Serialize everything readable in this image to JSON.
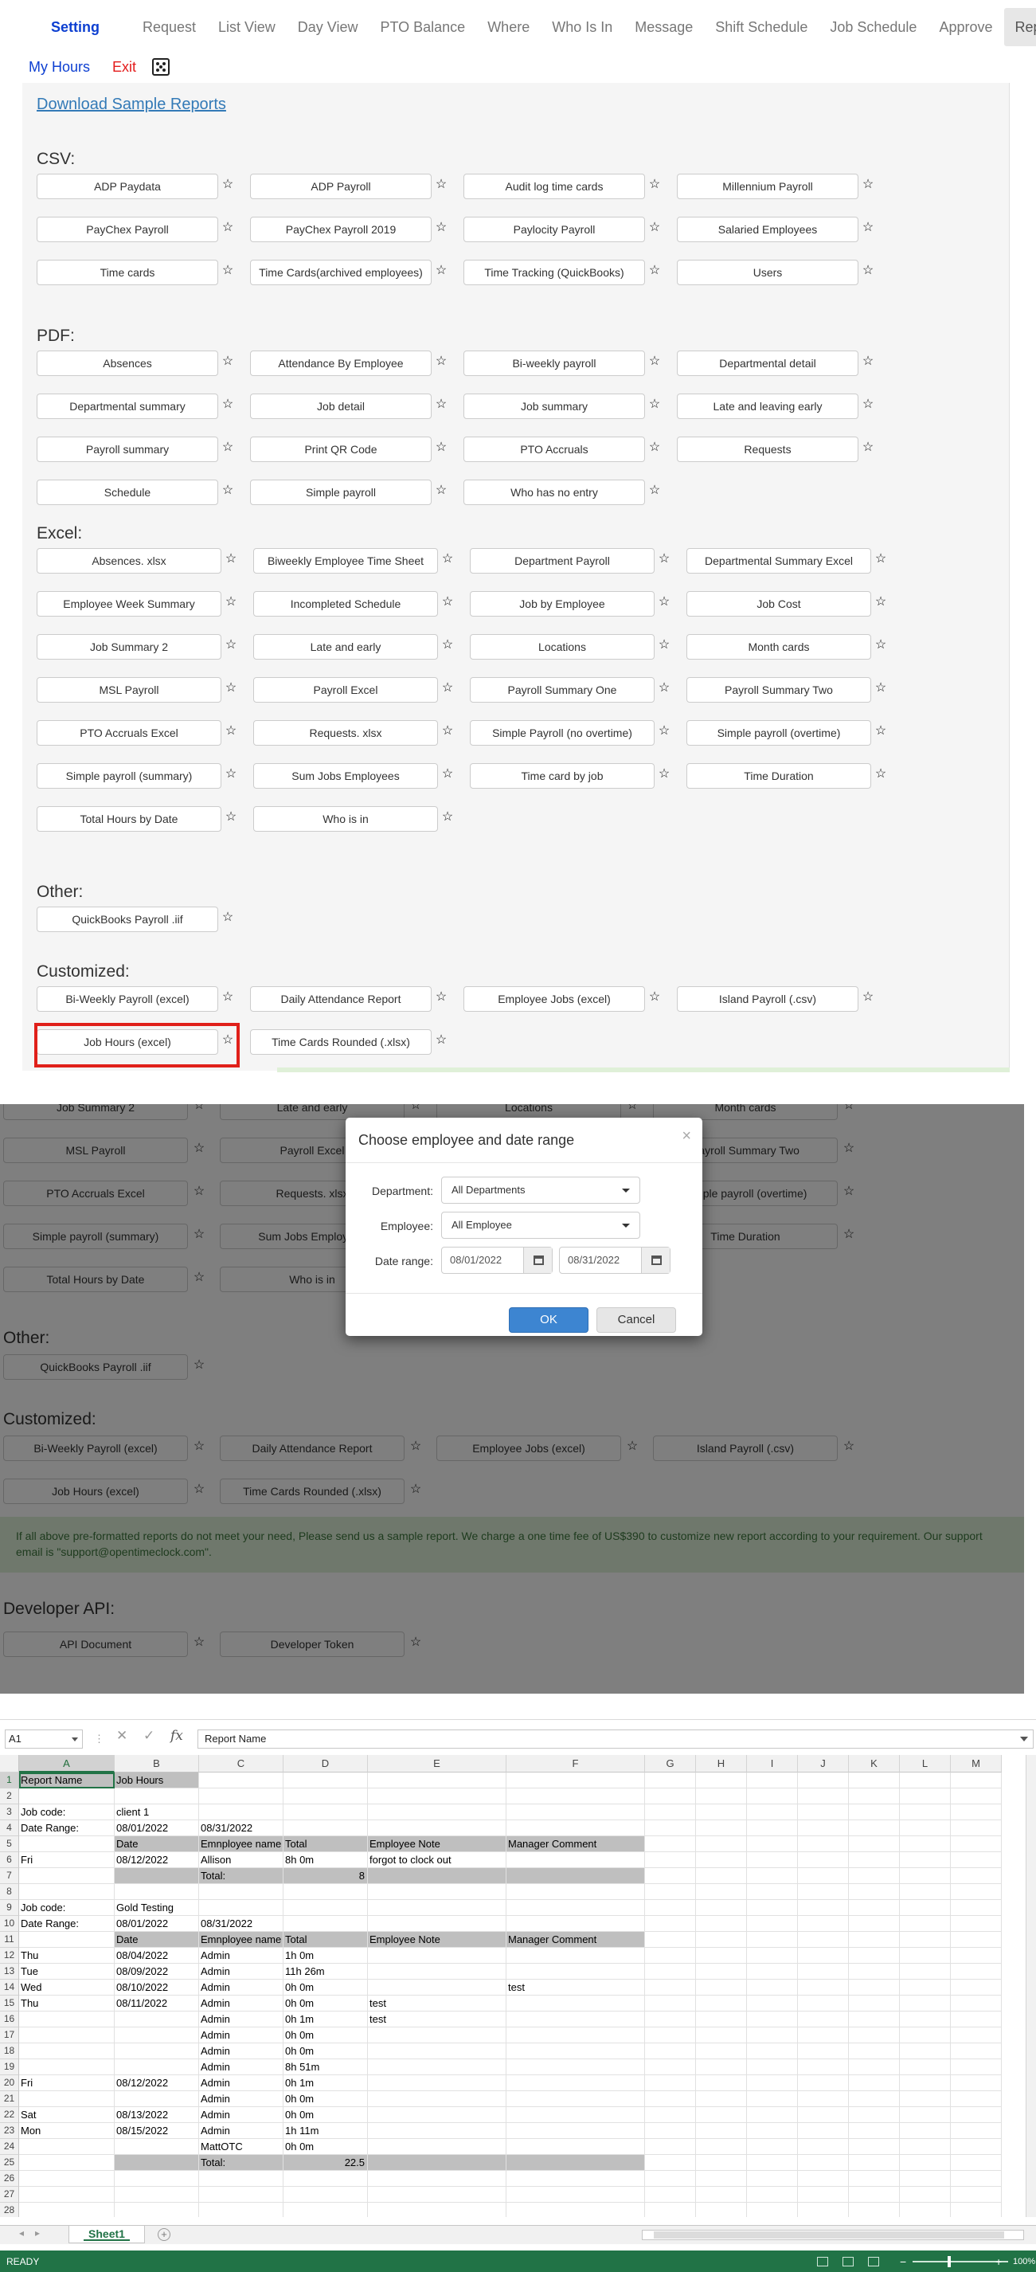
{
  "nav": {
    "brand": "Setting",
    "items": [
      "Request",
      "List View",
      "Day View",
      "PTO Balance",
      "Where",
      "Who Is In",
      "Message",
      "Shift Schedule",
      "Job Schedule",
      "Approve",
      "Reports"
    ],
    "active": "Reports",
    "row2": {
      "my_hours": "My Hours",
      "exit": "Exit",
      "icon": "dice-icon"
    }
  },
  "reports": {
    "download_link": "Download Sample Reports",
    "sections": [
      {
        "title": "CSV:",
        "items": [
          "ADP Paydata",
          "ADP Payroll",
          "Audit log time cards",
          "Millennium Payroll",
          "PayChex Payroll",
          "PayChex Payroll 2019",
          "Paylocity Payroll",
          "Salaried Employees",
          "Time cards",
          "Time Cards(archived employees)",
          "Time Tracking (QuickBooks)",
          "Users"
        ]
      },
      {
        "title": "PDF:",
        "items": [
          "Absences",
          "Attendance By Employee",
          "Bi-weekly payroll",
          "Departmental detail",
          "Departmental summary",
          "Job detail",
          "Job summary",
          "Late and leaving early",
          "Payroll summary",
          "Print QR Code",
          "PTO Accruals",
          "Requests",
          "Schedule",
          "Simple payroll",
          "Who has no entry"
        ]
      },
      {
        "title": "Excel:",
        "items": [
          "Absences. xlsx",
          "Biweekly Employee Time Sheet",
          "Department Payroll",
          "Departmental Summary Excel",
          "Employee Week Summary",
          "Incompleted Schedule",
          "Job by Employee",
          "Job Cost",
          "Job Summary 2",
          "Late and early",
          "Locations",
          "Month cards",
          "MSL Payroll",
          "Payroll Excel",
          "Payroll Summary One",
          "Payroll Summary Two",
          "PTO Accruals Excel",
          "Requests. xlsx",
          "Simple Payroll (no overtime)",
          "Simple payroll (overtime)",
          "Simple payroll (summary)",
          "Sum Jobs Employees",
          "Time card by job",
          "Time Duration",
          "Total Hours by Date",
          "Who is in"
        ]
      },
      {
        "title": "Other:",
        "items": [
          "QuickBooks Payroll .iif"
        ]
      },
      {
        "title": "Customized:",
        "items": [
          "Bi-Weekly Payroll (excel)",
          "Daily Attendance Report",
          "Employee Jobs (excel)",
          "Island Payroll (.csv)",
          "Job Hours (excel)",
          "Time Cards Rounded (.xlsx)"
        ]
      }
    ],
    "star_icon": "star-icon",
    "highlighted": "Job Hours (excel)"
  },
  "dimmed": {
    "excel_rows": [
      [
        "Job Summary 2",
        "Late and early",
        "Locations",
        "Month cards"
      ],
      [
        "MSL Payroll",
        "Payroll Excel",
        "Payroll Summary One",
        "Payroll Summary Two"
      ],
      [
        "PTO Accruals Excel",
        "Requests. xlsx",
        "Simple Payroll (no overtime)",
        "Simple payroll (overtime)"
      ],
      [
        "Simple payroll (summary)",
        "Sum Jobs Employees",
        "Time card by job",
        "Time Duration"
      ],
      [
        "Total Hours by Date",
        "Who is in"
      ]
    ],
    "other_title": "Other:",
    "other_items": [
      "QuickBooks Payroll .iif"
    ],
    "customized_title": "Customized:",
    "customized_rows": [
      [
        "Bi-Weekly Payroll (excel)",
        "Daily Attendance Report",
        "Employee Jobs (excel)",
        "Island Payroll (.csv)"
      ],
      [
        "Job Hours (excel)",
        "Time Cards Rounded (.xlsx)"
      ]
    ],
    "info_text": "If all above pre-formatted reports do not meet your need, Please send us a sample report. We charge a one time fee of US$390 to customize new report according to your requirement. Our support email is \"support@opentimeclock.com\".",
    "developer_title": "Developer API:",
    "developer_items": [
      "API Document",
      "Developer Token"
    ]
  },
  "modal": {
    "title": "Choose employee and date range",
    "close": "×",
    "department_label": "Department:",
    "department_value": "All Departments",
    "employee_label": "Employee:",
    "employee_value": "All Employee",
    "date_label": "Date range:",
    "date_from": "08/01/2022",
    "date_to": "08/31/2022",
    "ok": "OK",
    "cancel": "Cancel"
  },
  "excel": {
    "name_box": "A1",
    "formula": "Report Name",
    "columns": [
      "A",
      "B",
      "C",
      "D",
      "E",
      "F",
      "G",
      "H",
      "I",
      "J",
      "K",
      "L",
      "M"
    ],
    "rows": [
      [
        "Report Name",
        "Job Hours",
        "",
        "",
        "",
        ""
      ],
      [
        "",
        "",
        "",
        "",
        "",
        ""
      ],
      [
        "Job code:",
        "client 1",
        "",
        "",
        "",
        ""
      ],
      [
        "Date Range:",
        "08/01/2022",
        "08/31/2022",
        "",
        "",
        ""
      ],
      [
        "",
        "Date",
        "Emnployee name",
        "Total",
        "Employee Note",
        "Manager Comment"
      ],
      [
        "Fri",
        "08/12/2022",
        "Allison",
        "8h 0m",
        "forgot to clock out",
        ""
      ],
      [
        "",
        "",
        "Total:",
        "8",
        "",
        ""
      ],
      [
        "",
        "",
        "",
        "",
        "",
        ""
      ],
      [
        "Job code:",
        "Gold Testing",
        "",
        "",
        "",
        ""
      ],
      [
        "Date Range:",
        "08/01/2022",
        "08/31/2022",
        "",
        "",
        ""
      ],
      [
        "",
        "Date",
        "Emnployee name",
        "Total",
        "Employee Note",
        "Manager Comment"
      ],
      [
        "Thu",
        "08/04/2022",
        "Admin",
        "1h 0m",
        "",
        ""
      ],
      [
        "Tue",
        "08/09/2022",
        "Admin",
        "11h 26m",
        "",
        ""
      ],
      [
        "Wed",
        "08/10/2022",
        "Admin",
        "0h 0m",
        "",
        "test"
      ],
      [
        "Thu",
        "08/11/2022",
        "Admin",
        "0h 0m",
        "test",
        ""
      ],
      [
        "",
        "",
        "Admin",
        "0h 1m",
        "test",
        ""
      ],
      [
        "",
        "",
        "Admin",
        "0h 0m",
        "",
        ""
      ],
      [
        "",
        "",
        "Admin",
        "0h 0m",
        "",
        ""
      ],
      [
        "",
        "",
        "Admin",
        "8h 51m",
        "",
        ""
      ],
      [
        "Fri",
        "08/12/2022",
        "Admin",
        "0h 1m",
        "",
        ""
      ],
      [
        "",
        "",
        "Admin",
        "0h 0m",
        "",
        ""
      ],
      [
        "Sat",
        "08/13/2022",
        "Admin",
        "0h 0m",
        "",
        ""
      ],
      [
        "Mon",
        "08/15/2022",
        "Admin",
        "1h 11m",
        "",
        ""
      ],
      [
        "",
        "",
        "MattOTC",
        "0h 0m",
        "",
        ""
      ],
      [
        "",
        "",
        "Total:",
        "22.5",
        "",
        ""
      ],
      [
        "",
        "",
        "",
        "",
        "",
        ""
      ],
      [
        "",
        "",
        "",
        "",
        "",
        ""
      ],
      [
        "",
        "",
        "",
        "",
        "",
        ""
      ]
    ],
    "sheet_tab": "Sheet1",
    "add_sheet": "+",
    "status": "READY",
    "zoom": "100%"
  }
}
